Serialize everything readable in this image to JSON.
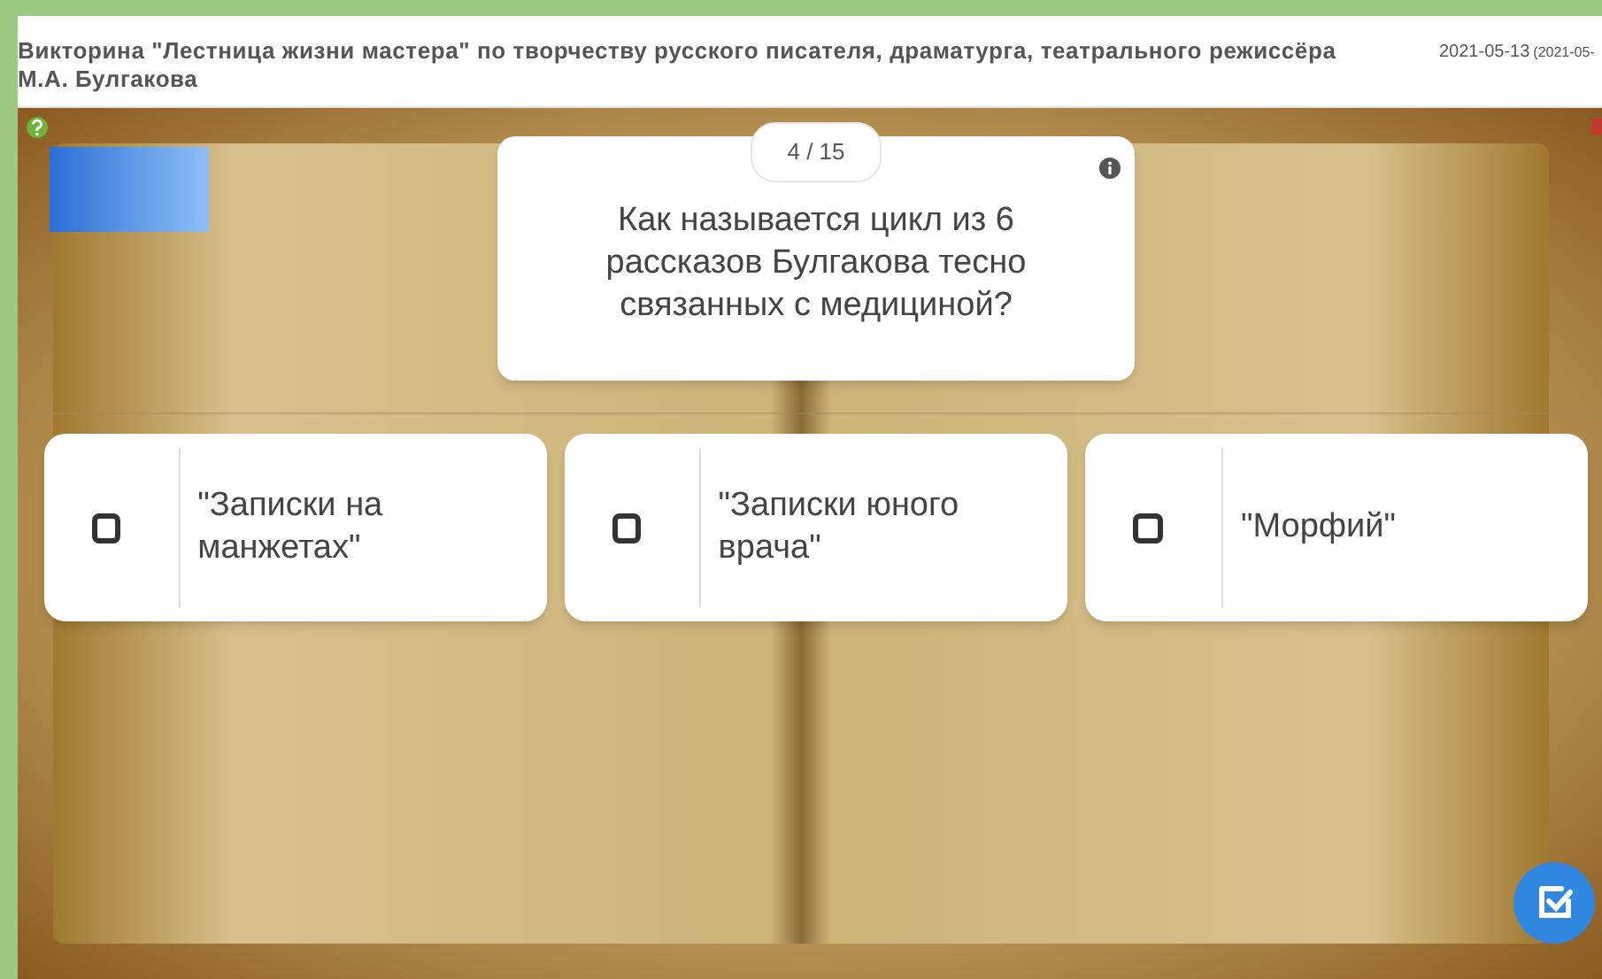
{
  "header": {
    "title": "Викторина \"Лестница жизни мастера\" по творчеству русского писателя, драматурга, театрального режиссёра М.А. Булгакова",
    "date": "2021-05-13",
    "date_extra": "(2021-05-"
  },
  "question": {
    "counter": "4 / 15",
    "text": "Как называется цикл из 6 рассказов Булгакова тесно связанных с медициной?"
  },
  "answers": [
    {
      "text": "\"Записки на манжетах\"",
      "checked": false
    },
    {
      "text": "\"Записки юного врача\"",
      "checked": false
    },
    {
      "text": "\"Морфий\"",
      "checked": false
    }
  ]
}
